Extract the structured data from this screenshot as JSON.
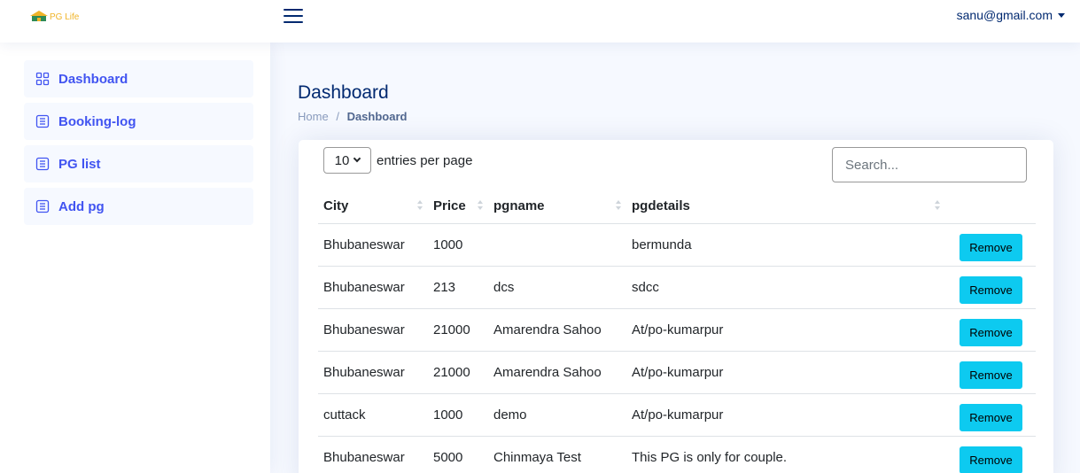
{
  "header": {
    "logo_text": "PG Life",
    "user_email": "sanu@gmail.com"
  },
  "sidebar": {
    "items": [
      {
        "label": "Dashboard",
        "icon": "grid-icon"
      },
      {
        "label": "Booking-log",
        "icon": "list-icon"
      },
      {
        "label": "PG list",
        "icon": "list-icon"
      },
      {
        "label": "Add pg",
        "icon": "list-icon"
      }
    ]
  },
  "page": {
    "title": "Dashboard",
    "breadcrumb": {
      "home": "Home",
      "separator": "/",
      "current": "Dashboard"
    }
  },
  "datatable": {
    "entries_value": "10",
    "entries_label": "entries per page",
    "search_placeholder": "Search...",
    "columns": [
      "City",
      "Price",
      "pgname",
      "pgdetails"
    ],
    "remove_label": "Remove",
    "rows": [
      {
        "city": "Bhubaneswar",
        "price": "1000",
        "pgname": "",
        "pgdetails": "bermunda"
      },
      {
        "city": "Bhubaneswar",
        "price": "213",
        "pgname": "dcs",
        "pgdetails": "sdcc"
      },
      {
        "city": "Bhubaneswar",
        "price": "21000",
        "pgname": "Amarendra Sahoo",
        "pgdetails": "At/po-kumarpur"
      },
      {
        "city": "Bhubaneswar",
        "price": "21000",
        "pgname": "Amarendra Sahoo",
        "pgdetails": "At/po-kumarpur"
      },
      {
        "city": "cuttack",
        "price": "1000",
        "pgname": "demo",
        "pgdetails": "At/po-kumarpur"
      },
      {
        "city": "Bhubaneswar",
        "price": "5000",
        "pgname": "Chinmaya Test",
        "pgdetails": "This PG is only for couple."
      }
    ]
  },
  "colors": {
    "accent": "#4154f1",
    "navy": "#012970",
    "info": "#0dcaf0"
  }
}
